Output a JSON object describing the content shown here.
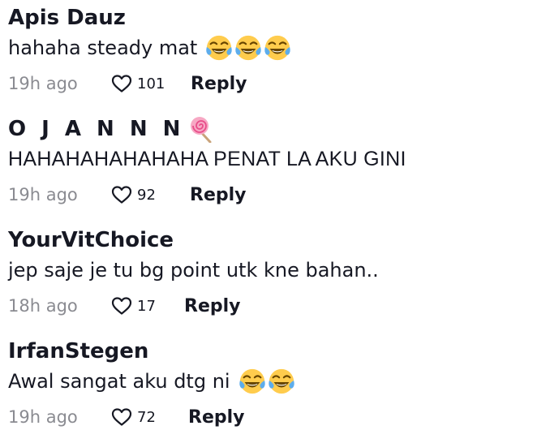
{
  "comments": [
    {
      "username": "Apis Dauz",
      "text": "hahaha steady mat",
      "emojis": [
        "joy-emoji",
        "joy-emoji",
        "joy-emoji"
      ],
      "time": "19h ago",
      "likes": "101",
      "reply_label": "Reply"
    },
    {
      "username": "O J A N N N",
      "username_icon": "lollipop-emoji",
      "text": "HAHAHAHAHAHAHA PENAT LA AKU GINI",
      "time": "19h ago",
      "likes": "92",
      "reply_label": "Reply"
    },
    {
      "username": "YourVitChoice",
      "text": "jep saje je tu bg point utk kne bahan..",
      "time": "18h ago",
      "likes": "17",
      "reply_label": "Reply"
    },
    {
      "username": "IrfanStegen",
      "text": "Awal sangat aku dtg ni",
      "emojis": [
        "joy-emoji",
        "joy-emoji"
      ],
      "time": "19h ago",
      "likes": "72",
      "reply_label": "Reply"
    }
  ],
  "colors": {
    "text": "#161823",
    "muted": "#8a8b91",
    "background": "#ffffff"
  }
}
